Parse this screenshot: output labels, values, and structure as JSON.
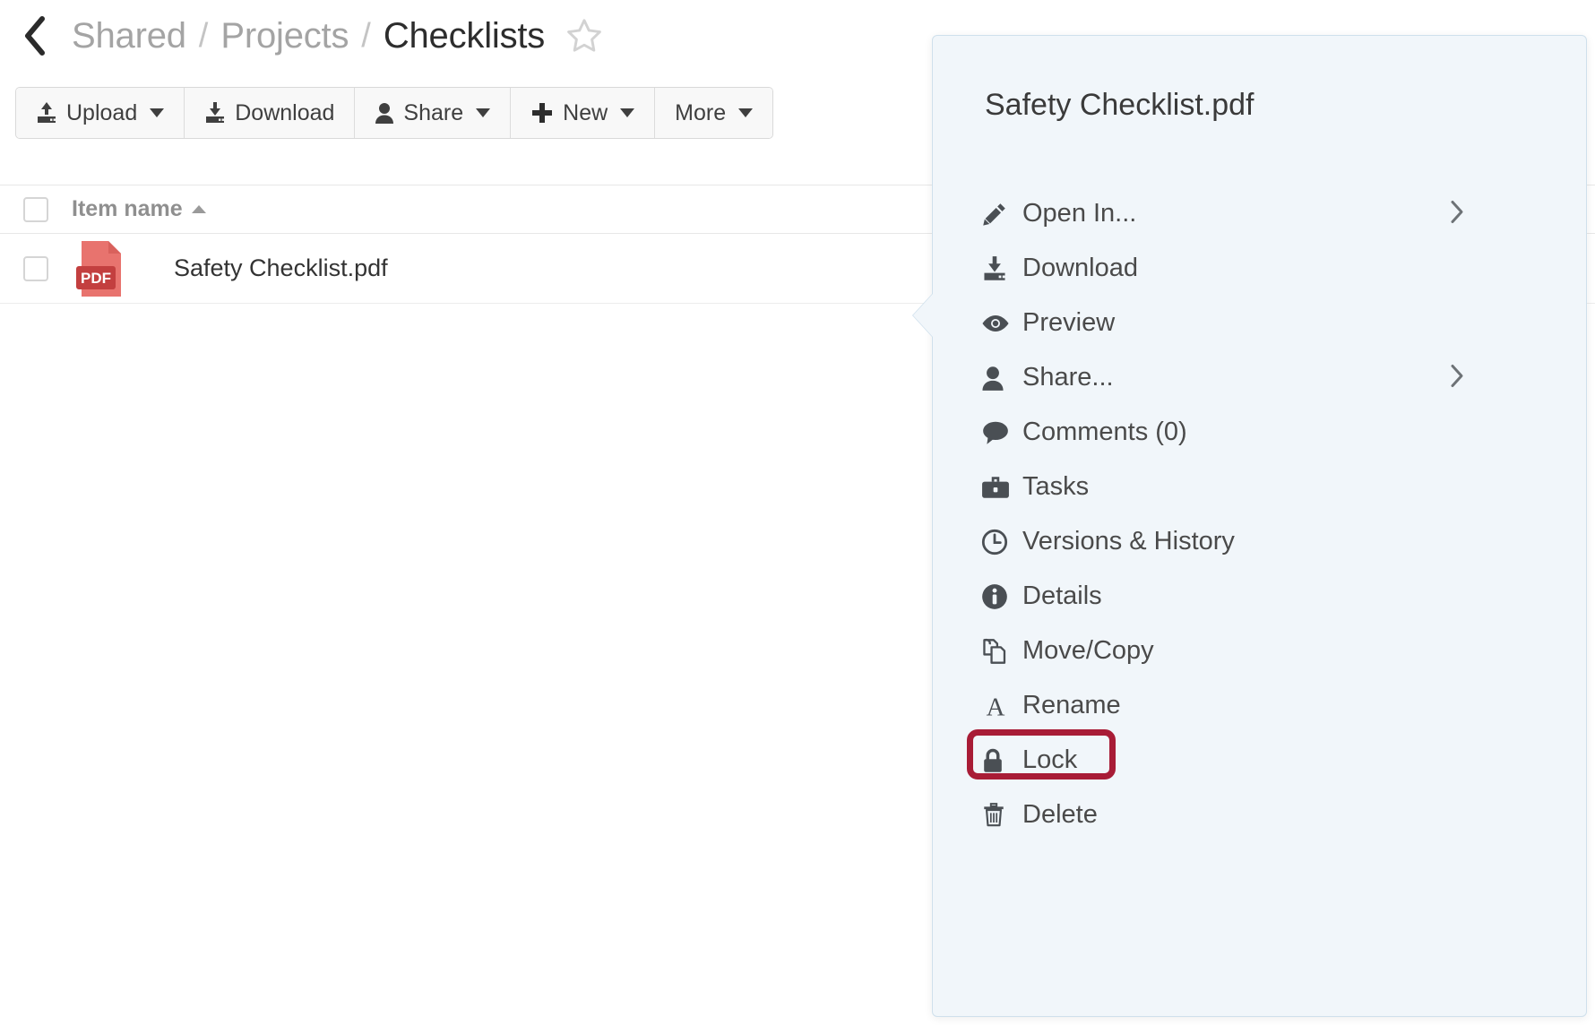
{
  "breadcrumb": {
    "back_icon": "chevron-left-icon",
    "items": [
      {
        "label": "Shared",
        "current": false
      },
      {
        "label": "Projects",
        "current": false
      },
      {
        "label": "Checklists",
        "current": true
      }
    ],
    "separator": "/",
    "favorite_icon": "star-outline-icon"
  },
  "toolbar": {
    "buttons": [
      {
        "label": "Upload",
        "icon": "upload-icon",
        "caret": true
      },
      {
        "label": "Download",
        "icon": "download-icon",
        "caret": false
      },
      {
        "label": "Share",
        "icon": "person-icon",
        "caret": true
      },
      {
        "label": "New",
        "icon": "plus-icon",
        "caret": true
      },
      {
        "label": "More",
        "icon": "",
        "caret": true
      }
    ],
    "view_toggle": {
      "icon": "list-view-icon",
      "caret": true
    }
  },
  "table": {
    "columns": [
      {
        "label": "Item name",
        "sort": "asc"
      }
    ],
    "select_all_checked": false,
    "rows": [
      {
        "name": "Safety Checklist.pdf",
        "icon": "pdf-file-icon",
        "icon_label": "PDF",
        "checked": false
      }
    ]
  },
  "context_menu": {
    "title": "Safety Checklist.pdf",
    "items": [
      {
        "label": "Open In...",
        "icon": "pencil-icon",
        "submenu": true
      },
      {
        "label": "Download",
        "icon": "download-icon",
        "submenu": false
      },
      {
        "label": "Preview",
        "icon": "eye-icon",
        "submenu": false
      },
      {
        "label": "Share...",
        "icon": "person-icon",
        "submenu": true
      },
      {
        "label": "Comments (0)",
        "icon": "comment-bubble-icon",
        "submenu": false
      },
      {
        "label": "Tasks",
        "icon": "briefcase-icon",
        "submenu": false
      },
      {
        "label": "Versions & History",
        "icon": "clock-icon",
        "submenu": false
      },
      {
        "label": "Details",
        "icon": "info-circle-icon",
        "submenu": false
      },
      {
        "label": "Move/Copy",
        "icon": "copy-icon",
        "submenu": false
      },
      {
        "label": "Rename",
        "icon": "letter-a-icon",
        "submenu": false
      },
      {
        "label": "Lock",
        "icon": "lock-icon",
        "submenu": false,
        "highlighted": true
      },
      {
        "label": "Delete",
        "icon": "trash-icon",
        "submenu": false
      }
    ],
    "submenu_chevron": "chevron-right-icon"
  },
  "colors": {
    "panel_bg": "#f1f6fa",
    "panel_border": "#cfe0ec",
    "highlight_border": "#a81c36",
    "pdf_icon": "#e8736e",
    "pdf_badge": "#c33f3f",
    "text_primary": "#3a3a3a",
    "text_muted": "#a4a4a4"
  }
}
